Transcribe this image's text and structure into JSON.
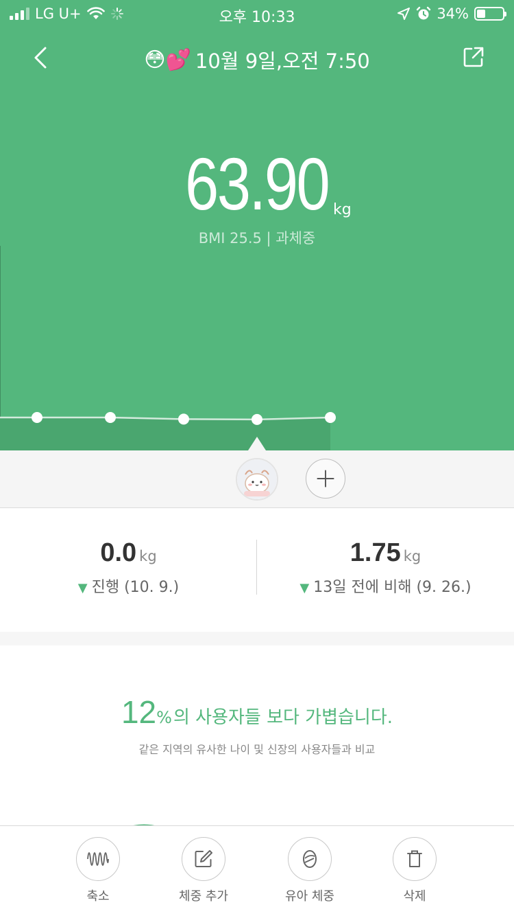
{
  "status_bar": {
    "carrier": "LG U+",
    "time": "오후 10:33",
    "battery": "34%",
    "battery_level": 0.34
  },
  "header": {
    "emojis": "😳💕",
    "title": "10월 9일,오전 7:50",
    "icons": {
      "back": "chevron-left-icon",
      "share": "share-icon"
    }
  },
  "measurement": {
    "weight": "63.90",
    "unit": "kg",
    "bmi": "BMI 25.5 | 과체중"
  },
  "trend": {
    "values": [
      63.9,
      63.9,
      63.75,
      63.72,
      63.9
    ],
    "selected_index": 3
  },
  "user": {
    "avatar_icon": "user-avatar-icon",
    "add_icon": "plus-icon"
  },
  "stats": {
    "left": {
      "value": "0.0",
      "unit": "kg",
      "caption": "진행 (10. 9.)"
    },
    "right": {
      "value": "1.75",
      "unit": "kg",
      "caption": "13일 전에 비해 (9. 26.)"
    },
    "trend_icon": "down-triangle-icon"
  },
  "comparison": {
    "percent": "12",
    "percent_sign": "%",
    "text": "의 사용자들 보다 가볍습니다.",
    "subtext": "같은 지역의 유사한 나이 및 신장의 사용자들과 비교"
  },
  "toolbar": [
    {
      "label": "축소",
      "icon": "waveform-icon"
    },
    {
      "label": "체중 추가",
      "icon": "edit-icon"
    },
    {
      "label": "유아 체중",
      "icon": "baby-icon"
    },
    {
      "label": "삭제",
      "icon": "trash-icon"
    }
  ],
  "colors": {
    "accent": "#54b77d",
    "chart_fill": "#4aa66f"
  }
}
